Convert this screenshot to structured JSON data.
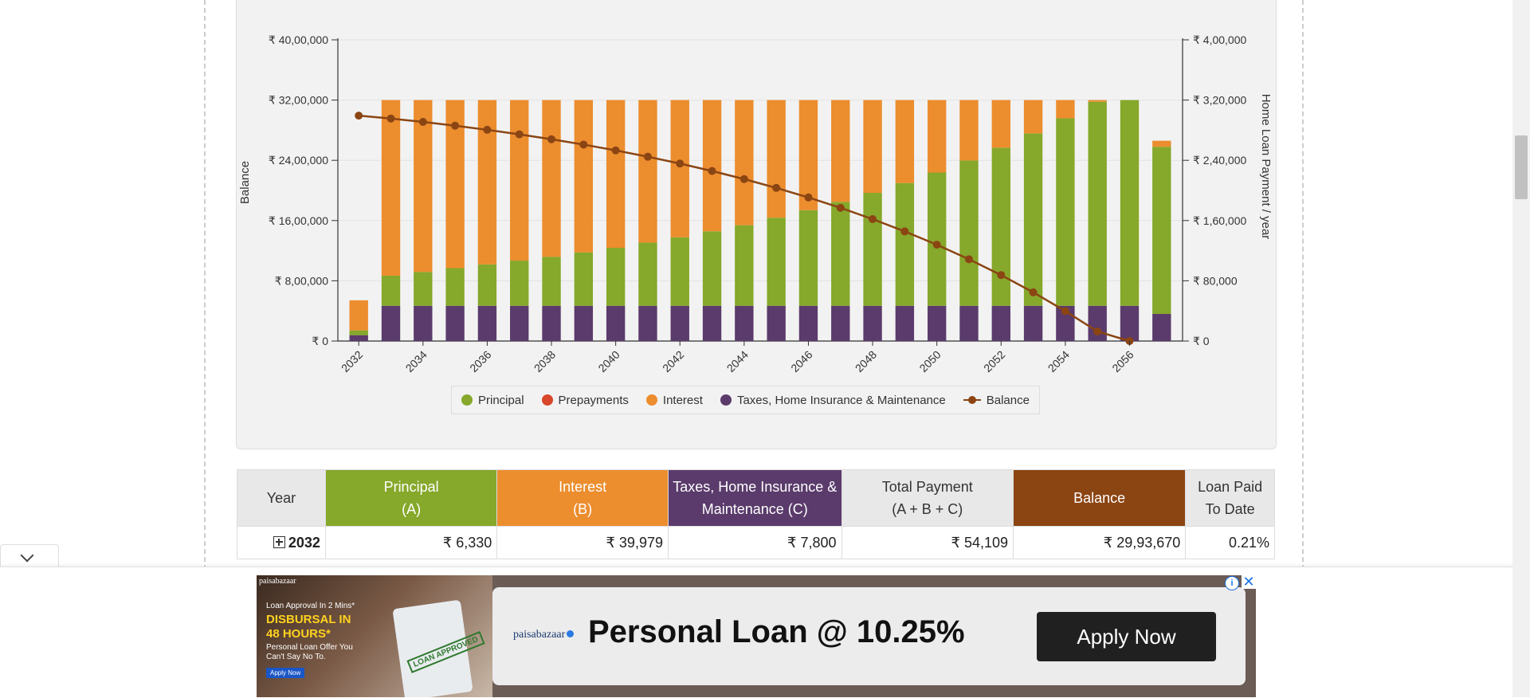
{
  "chart_data": {
    "type": "bar",
    "stacked": true,
    "x": [
      "2032",
      "2033",
      "2034",
      "2035",
      "2036",
      "2037",
      "2038",
      "2039",
      "2040",
      "2041",
      "2042",
      "2043",
      "2044",
      "2045",
      "2046",
      "2047",
      "2048",
      "2049",
      "2050",
      "2051",
      "2052",
      "2053",
      "2054",
      "2055",
      "2056",
      "2057"
    ],
    "x_ticks": [
      "2032",
      "2034",
      "2036",
      "2038",
      "2040",
      "2042",
      "2044",
      "2046",
      "2048",
      "2050",
      "2052",
      "2054",
      "2056"
    ],
    "series": [
      {
        "name": "Taxes, Home Insurance & Maintenance",
        "color": "#5a3b6b",
        "axis": "right",
        "values": [
          7800,
          46800,
          46800,
          46800,
          46800,
          46800,
          46800,
          46800,
          46800,
          46800,
          46800,
          46800,
          46800,
          46800,
          46800,
          46800,
          46800,
          46800,
          46800,
          46800,
          46800,
          46800,
          46800,
          46800,
          46800,
          36000
        ]
      },
      {
        "name": "Principal",
        "color": "#86a82b",
        "axis": "right",
        "values": [
          6330,
          40000,
          45000,
          50000,
          55000,
          60000,
          65000,
          71000,
          77000,
          84000,
          91000,
          99000,
          107000,
          117000,
          127000,
          138000,
          150000,
          163000,
          177000,
          193000,
          210000,
          229000,
          249000,
          271000,
          295000,
          222000
        ]
      },
      {
        "name": "Prepayments",
        "color": "#d9472b",
        "axis": "right",
        "values": [
          0,
          0,
          0,
          0,
          0,
          0,
          0,
          0,
          0,
          0,
          0,
          0,
          0,
          0,
          0,
          0,
          0,
          0,
          0,
          0,
          0,
          0,
          0,
          0,
          0,
          0
        ]
      },
      {
        "name": "Interest",
        "color": "#ec8d2e",
        "axis": "right",
        "values": [
          39979,
          280000,
          275000,
          270000,
          265000,
          260000,
          255000,
          249000,
          243000,
          236000,
          229000,
          221000,
          213000,
          203000,
          193000,
          182000,
          170000,
          157000,
          143000,
          127000,
          110000,
          91000,
          71000,
          49000,
          25000,
          8000
        ]
      }
    ],
    "line": {
      "name": "Balance",
      "color": "#8b4513",
      "axis": "left",
      "values": [
        2993670,
        2955000,
        2910000,
        2860000,
        2805000,
        2745000,
        2680000,
        2609000,
        2532000,
        2448000,
        2357000,
        2258000,
        2151000,
        2034000,
        1907000,
        1769000,
        1619000,
        1456000,
        1279000,
        1086000,
        876000,
        647000,
        398000,
        127000,
        0,
        0
      ]
    },
    "left_axis": {
      "label": "Balance",
      "ylim": [
        0,
        4000000
      ],
      "ticks": [
        "₹ 0",
        "₹ 8,00,000",
        "₹ 16,00,000",
        "₹ 24,00,000",
        "₹ 32,00,000",
        "₹ 40,00,000"
      ]
    },
    "right_axis": {
      "label": "Home Loan Payment / year",
      "ylim": [
        0,
        400000
      ],
      "ticks": [
        "₹ 0",
        "₹ 80,000",
        "₹ 1,60,000",
        "₹ 2,40,000",
        "₹ 3,20,000",
        "₹ 4,00,000"
      ]
    },
    "legend": {
      "placement": "bottom"
    },
    "grid": true
  },
  "legend_items": {
    "principal": "Principal",
    "prepayments": "Prepayments",
    "interest": "Interest",
    "taxes": "Taxes, Home Insurance & Maintenance",
    "balance": "Balance"
  },
  "table": {
    "headers": {
      "year": "Year",
      "principal": [
        "Principal",
        "(A)"
      ],
      "interest": [
        "Interest",
        "(B)"
      ],
      "taxes": [
        "Taxes, Home Insurance &",
        "Maintenance (C)"
      ],
      "total": [
        "Total Payment",
        "(A + B + C)"
      ],
      "balance": "Balance",
      "paid": [
        "Loan Paid",
        "To Date"
      ]
    },
    "rows": [
      {
        "year": "2032",
        "principal": "₹ 6,330",
        "interest": "₹ 39,979",
        "taxes": "₹ 7,800",
        "total": "₹ 54,109",
        "balance": "₹ 29,93,670",
        "paid": "0.21%"
      }
    ]
  },
  "ad": {
    "brand_small": "paisabazaar",
    "line1": "Loan Approval In 2 Mins*",
    "line2": "DISBURSAL IN 48 HOURS*",
    "line3": "Personal Loan Offer You Can't Say No To.",
    "small_button": "Apply Now",
    "stamp": "LOAN APPROVED",
    "brand": "paisabazaar",
    "headline": "Personal Loan @ 10.25%",
    "button": "Apply Now",
    "info": "i",
    "close": "✕"
  },
  "colors": {
    "principal": "#86a82b",
    "prepayments": "#d9472b",
    "interest": "#ec8d2e",
    "taxes": "#5a3b6b",
    "balance": "#8b4513"
  }
}
